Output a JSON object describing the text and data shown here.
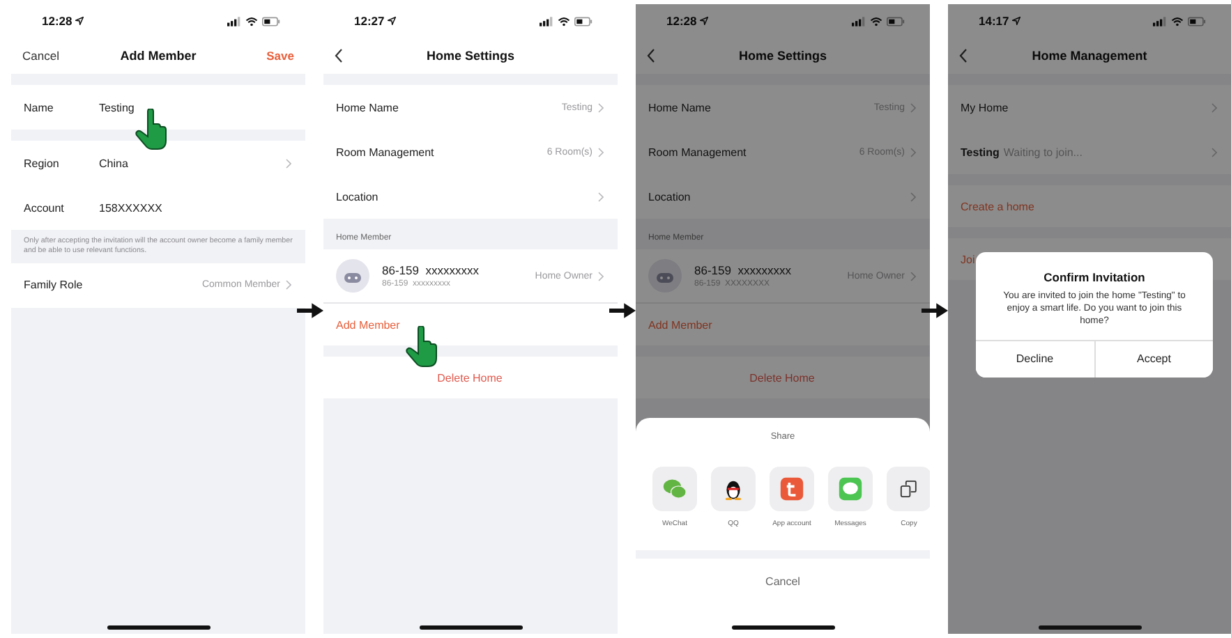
{
  "screens": [
    {
      "dimmed": false,
      "status": {
        "time": "12:28"
      },
      "nav": {
        "left": "Cancel",
        "title": "Add Member",
        "right": "Save"
      },
      "blocks": [
        {
          "kind": "gap"
        },
        {
          "kind": "field",
          "label": "Name",
          "value": "Testing",
          "chevron": false,
          "pointer": true
        },
        {
          "kind": "gap"
        },
        {
          "kind": "field",
          "label": "Region",
          "value": "China",
          "chevron": true,
          "pointer": false
        },
        {
          "kind": "field",
          "label": "Account",
          "value": "158XXXXXX",
          "chevron": false,
          "pointer": false
        },
        {
          "kind": "note",
          "text": "Only after accepting the invitation will the account owner become a family member and be able to use relevant functions."
        },
        {
          "kind": "row",
          "label": "Family Role",
          "value": "Common Member",
          "chevron": true,
          "pointer": false
        }
      ]
    },
    {
      "dimmed": false,
      "status": {
        "time": "12:27"
      },
      "nav": {
        "back": true,
        "title": "Home Settings"
      },
      "blocks": [
        {
          "kind": "gap"
        },
        {
          "kind": "row",
          "label": "Home Name",
          "value": "Testing",
          "chevron": true,
          "pointer": false
        },
        {
          "kind": "row",
          "label": "Room Management",
          "value": "6 Room(s)",
          "chevron": true,
          "pointer": false
        },
        {
          "kind": "row",
          "label": "Location",
          "chevron": true,
          "pointer": false
        },
        {
          "kind": "header",
          "text": "Home Member"
        },
        {
          "kind": "member",
          "name": "86-159  xxxxxxxxx",
          "sub": "86-159  xxxxxxxxx",
          "role": "Home Owner"
        },
        {
          "kind": "link",
          "text": "Add Member",
          "pointer": true
        },
        {
          "kind": "gap"
        },
        {
          "kind": "danger",
          "text": "Delete Home"
        }
      ]
    },
    {
      "dimmed": true,
      "status": {
        "time": "12:28"
      },
      "nav": {
        "back": true,
        "title": "Home Settings"
      },
      "blocks": [
        {
          "kind": "gap"
        },
        {
          "kind": "row",
          "label": "Home Name",
          "value": "Testing",
          "chevron": true,
          "pointer": false
        },
        {
          "kind": "row",
          "label": "Room Management",
          "value": "6 Room(s)",
          "chevron": true,
          "pointer": false
        },
        {
          "kind": "row",
          "label": "Location",
          "chevron": true,
          "pointer": false
        },
        {
          "kind": "header",
          "text": "Home Member"
        },
        {
          "kind": "member",
          "name": "86-159  xxxxxxxxx",
          "sub": "86-159  XXXXXXXX",
          "role": "Home Owner"
        },
        {
          "kind": "link",
          "text": "Add Member",
          "pointer": false
        },
        {
          "kind": "gap"
        },
        {
          "kind": "danger",
          "text": "Delete Home"
        }
      ],
      "sheet": {
        "title": "Share",
        "targets": [
          {
            "kind": "wechat",
            "label": "WeChat"
          },
          {
            "kind": "qq",
            "label": "QQ"
          },
          {
            "kind": "app",
            "label": "App account"
          },
          {
            "kind": "messages",
            "label": "Messages"
          },
          {
            "kind": "copy",
            "label": "Copy"
          }
        ],
        "cancel": "Cancel"
      }
    },
    {
      "dimmed": true,
      "status": {
        "time": "14:17"
      },
      "nav": {
        "back": true,
        "title": "Home Management"
      },
      "blocks": [
        {
          "kind": "gap"
        },
        {
          "kind": "row",
          "label": "My Home",
          "chevron": true,
          "pointer": false
        },
        {
          "kind": "pending",
          "name": "Testing",
          "text": "Waiting to join...",
          "chevron": true
        },
        {
          "kind": "gap"
        },
        {
          "kind": "link",
          "text": "Create a home",
          "pointer": false
        },
        {
          "kind": "gap"
        },
        {
          "kind": "link",
          "text": "Joi",
          "pointer": false
        }
      ],
      "dialog": {
        "title": "Confirm Invitation",
        "message": "You are invited to join the home \"Testing\" to enjoy a smart life. Do you want to join this home?",
        "buttons": [
          "Decline",
          "Accept"
        ]
      }
    }
  ]
}
